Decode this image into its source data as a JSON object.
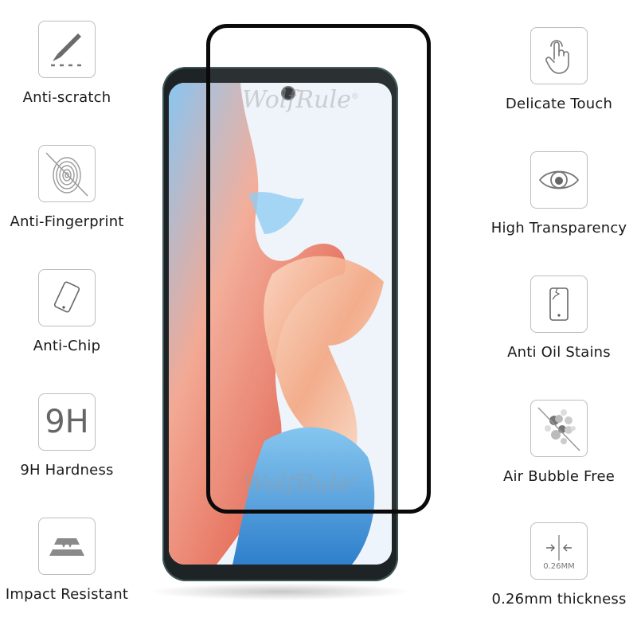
{
  "brand": {
    "watermark": "WolfRule",
    "registered_mark": "®"
  },
  "left_features": [
    {
      "icon": "scalpel-scratch-icon",
      "label": "Anti-scratch"
    },
    {
      "icon": "fingerprint-crossed-icon",
      "label": "Anti-Fingerprint"
    },
    {
      "icon": "tilted-phone-icon",
      "label": "Anti-Chip"
    },
    {
      "icon": "9h-icon",
      "icon_text": "9H",
      "label": "9H Hardness"
    },
    {
      "icon": "impact-layers-icon",
      "label": "Impact Resistant"
    }
  ],
  "right_features": [
    {
      "icon": "touch-hand-icon",
      "label": "Delicate Touch"
    },
    {
      "icon": "eye-icon",
      "label": "High Transparency"
    },
    {
      "icon": "cracked-phone-icon",
      "label": "Anti Oil Stains"
    },
    {
      "icon": "bubbles-crossed-icon",
      "label": "Air Bubble Free"
    },
    {
      "icon": "thickness-icon",
      "icon_text": "0.26MM",
      "label": "0.26mm thickness"
    }
  ],
  "colors": {
    "icon_stroke": "#777777",
    "icon_border": "#bdbdbd",
    "glass_edge": "#0a0a0a",
    "phone_frame": "#1e2426"
  }
}
